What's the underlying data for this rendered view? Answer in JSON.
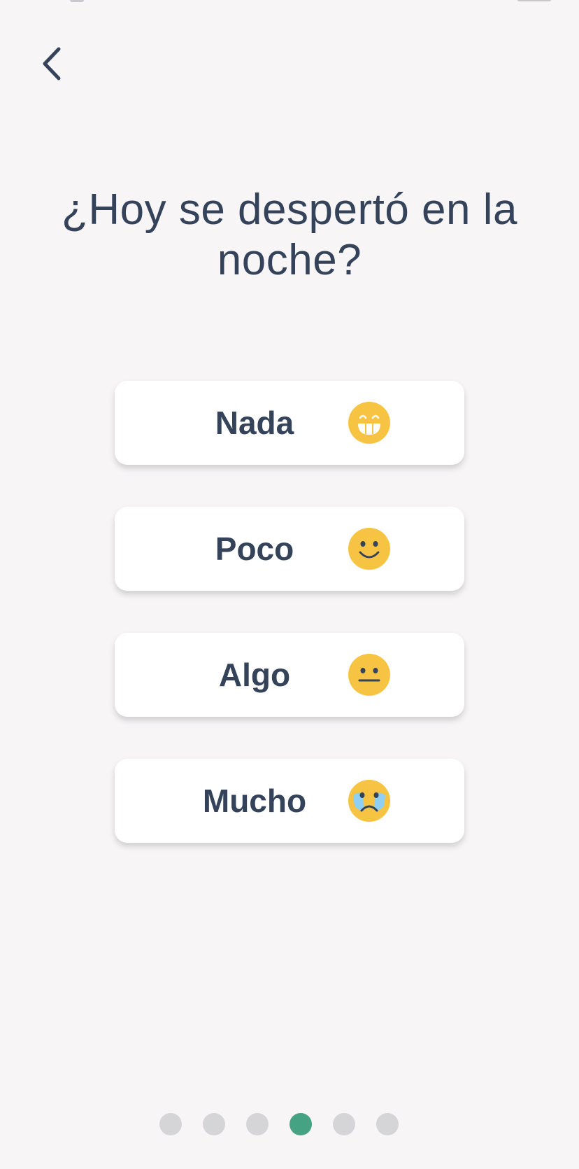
{
  "header": {
    "back_icon": "chevron-left-icon"
  },
  "question": {
    "text": "¿Hoy se despertó en la noche?"
  },
  "options": [
    {
      "label": "Nada",
      "emoji": "grinning-face-icon"
    },
    {
      "label": "Poco",
      "emoji": "slightly-smiling-face-icon"
    },
    {
      "label": "Algo",
      "emoji": "neutral-face-icon"
    },
    {
      "label": "Mucho",
      "emoji": "crying-face-icon"
    }
  ],
  "pagination": {
    "total": 6,
    "current": 4
  },
  "colors": {
    "background": "#f7f5f6",
    "text": "#34435a",
    "card": "#ffffff",
    "emoji_yellow": "#f6c343",
    "tear_blue": "#8fcff4",
    "active_dot": "#45a282",
    "inactive_dot": "#d5d4d6"
  }
}
